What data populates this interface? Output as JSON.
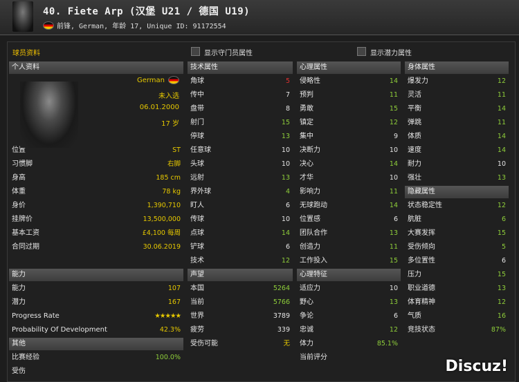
{
  "header": {
    "title": "40. Fiete Arp (汉堡 U21 / 德国 U19)",
    "subtitle": "前锋, German, 年龄 17, Unique ID: 91172554"
  },
  "topbar": {
    "section_label": "球员资料",
    "show_gk": "显示守门员属性",
    "show_potential": "显示潜力属性"
  },
  "personal": {
    "header": "个人资料",
    "nationality": "German",
    "selection": "未入选",
    "birth": "06.01.2000",
    "age": "17 岁",
    "rows": [
      {
        "label": "位置",
        "value": "ST"
      },
      {
        "label": "习惯脚",
        "value": "右脚"
      },
      {
        "label": "身高",
        "value": "185 cm"
      },
      {
        "label": "体重",
        "value": "78 kg"
      },
      {
        "label": "身价",
        "value": "1,390,710"
      },
      {
        "label": "挂牌价",
        "value": "13,500,000"
      },
      {
        "label": "基本工资",
        "value": "£4,100 每周"
      },
      {
        "label": "合同过期",
        "value": "30.06.2019"
      }
    ]
  },
  "ability": {
    "header": "能力",
    "rows": [
      {
        "label": "能力",
        "value": "107"
      },
      {
        "label": "潜力",
        "value": "167"
      },
      {
        "label": "Progress Rate",
        "value": "★★★★★"
      },
      {
        "label": "Probability Of Development",
        "value": "42.3%"
      }
    ]
  },
  "other": {
    "header": "其他",
    "rows": [
      {
        "label": "比赛经验",
        "value": "100.0%"
      },
      {
        "label": "受伤",
        "value": ""
      }
    ]
  },
  "technical": {
    "header": "技术属性",
    "rows": [
      {
        "label": "角球",
        "value": "5",
        "c": "r"
      },
      {
        "label": "传中",
        "value": "7",
        "c": "w"
      },
      {
        "label": "盘带",
        "value": "8",
        "c": "w"
      },
      {
        "label": "射门",
        "value": "15",
        "c": "g"
      },
      {
        "label": "停球",
        "value": "13",
        "c": "g"
      },
      {
        "label": "任意球",
        "value": "10",
        "c": "w"
      },
      {
        "label": "头球",
        "value": "10",
        "c": "w"
      },
      {
        "label": "远射",
        "value": "13",
        "c": "g"
      },
      {
        "label": "界外球",
        "value": "4",
        "c": "g"
      },
      {
        "label": "盯人",
        "value": "6",
        "c": "w"
      },
      {
        "label": "传球",
        "value": "10",
        "c": "w"
      },
      {
        "label": "点球",
        "value": "14",
        "c": "g"
      },
      {
        "label": "铲球",
        "value": "6",
        "c": "w"
      },
      {
        "label": "技术",
        "value": "12",
        "c": "g"
      }
    ]
  },
  "reputation": {
    "header": "声望",
    "rows": [
      {
        "label": "本国",
        "value": "5264",
        "c": "g"
      },
      {
        "label": "当前",
        "value": "5766",
        "c": "g"
      },
      {
        "label": "世界",
        "value": "3789",
        "c": "w"
      },
      {
        "label": "疲劳",
        "value": "339",
        "c": "w"
      },
      {
        "label": "受伤可能",
        "value": "无",
        "c": "y"
      }
    ]
  },
  "mental": {
    "header": "心理属性",
    "rows": [
      {
        "label": "侵略性",
        "value": "14",
        "c": "g"
      },
      {
        "label": "预判",
        "value": "11",
        "c": "g"
      },
      {
        "label": "勇敢",
        "value": "15",
        "c": "g"
      },
      {
        "label": "镇定",
        "value": "12",
        "c": "g"
      },
      {
        "label": "集中",
        "value": "9",
        "c": "w"
      },
      {
        "label": "决断力",
        "value": "10",
        "c": "w"
      },
      {
        "label": "决心",
        "value": "14",
        "c": "g"
      },
      {
        "label": "才华",
        "value": "10",
        "c": "w"
      },
      {
        "label": "影响力",
        "value": "11",
        "c": "g"
      },
      {
        "label": "无球跑动",
        "value": "14",
        "c": "g"
      },
      {
        "label": "位置感",
        "value": "6",
        "c": "w"
      },
      {
        "label": "团队合作",
        "value": "13",
        "c": "g"
      },
      {
        "label": "创造力",
        "value": "11",
        "c": "g"
      },
      {
        "label": "工作投入",
        "value": "15",
        "c": "g"
      }
    ]
  },
  "mental_traits": {
    "header": "心理特征",
    "rows": [
      {
        "label": "适应力",
        "value": "10",
        "c": "w"
      },
      {
        "label": "野心",
        "value": "13",
        "c": "g"
      },
      {
        "label": "争论",
        "value": "6",
        "c": "w"
      },
      {
        "label": "忠诚",
        "value": "12",
        "c": "g"
      },
      {
        "label": "体力",
        "value": "85.1%",
        "c": "g"
      },
      {
        "label": "当前评分",
        "value": "",
        "c": "w"
      }
    ]
  },
  "physical": {
    "header": "身体属性",
    "rows": [
      {
        "label": "爆发力",
        "value": "12",
        "c": "g"
      },
      {
        "label": "灵活",
        "value": "11",
        "c": "g"
      },
      {
        "label": "平衡",
        "value": "14",
        "c": "g"
      },
      {
        "label": "弹跳",
        "value": "11",
        "c": "g"
      },
      {
        "label": "体质",
        "value": "14",
        "c": "g"
      },
      {
        "label": "速度",
        "value": "14",
        "c": "g"
      },
      {
        "label": "耐力",
        "value": "10",
        "c": "w"
      },
      {
        "label": "强壮",
        "value": "13",
        "c": "g"
      }
    ]
  },
  "hidden": {
    "header": "隐藏属性",
    "rows": [
      {
        "label": "状态稳定性",
        "value": "12",
        "c": "g"
      },
      {
        "label": "肮脏",
        "value": "6",
        "c": "g"
      },
      {
        "label": "大赛发挥",
        "value": "15",
        "c": "g"
      },
      {
        "label": "受伤倾向",
        "value": "5",
        "c": "g"
      },
      {
        "label": "多位置性",
        "value": "6",
        "c": "w"
      },
      {
        "label": "压力",
        "value": "15",
        "c": "g"
      },
      {
        "label": "职业道德",
        "value": "13",
        "c": "g"
      },
      {
        "label": "体育精神",
        "value": "12",
        "c": "g"
      },
      {
        "label": "气质",
        "value": "16",
        "c": "g"
      },
      {
        "label": "竞技状态",
        "value": "87%",
        "c": "g"
      }
    ]
  },
  "watermark": "Discuz!"
}
